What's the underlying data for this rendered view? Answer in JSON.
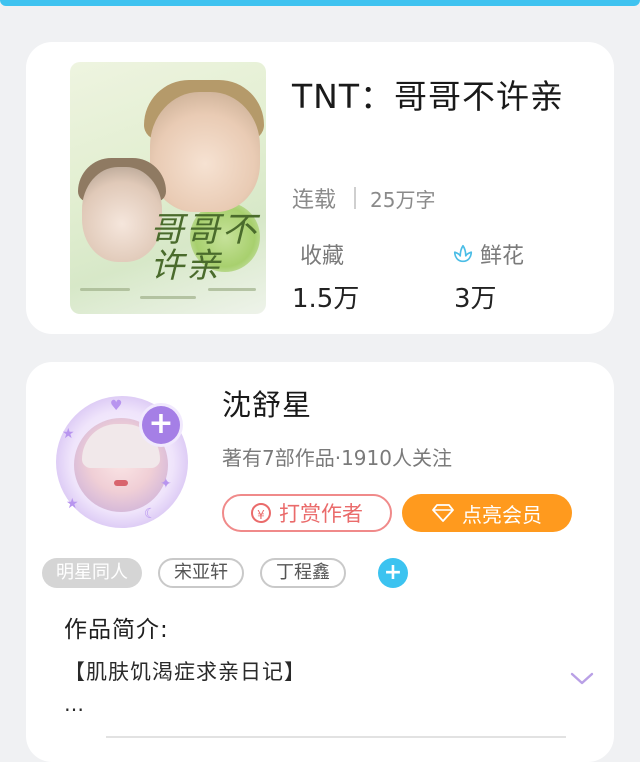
{
  "book": {
    "title": "TNT：哥哥不许亲",
    "status": "连载",
    "word_count": "25万字",
    "favorites_label": "收藏",
    "favorites_value": "1.5万",
    "flowers_label": "鲜花",
    "flowers_value": "3万",
    "cover_text": "哥哥不许亲"
  },
  "author": {
    "name": "沈舒星",
    "meta": "著有7部作品·1910人关注",
    "reward_label": "打赏作者",
    "vip_label": "点亮会员"
  },
  "tags": [
    "明星同人",
    "宋亚轩",
    "丁程鑫"
  ],
  "intro": {
    "heading": "作品简介:",
    "text": "【肌肤饥渴症求亲日记】",
    "ellipsis": "…"
  },
  "colors": {
    "accent_blue": "#3cc3f0",
    "vip_orange": "#ff9a1e",
    "reward_red": "#ea6b6b",
    "follow_purple": "#a57fe6"
  }
}
